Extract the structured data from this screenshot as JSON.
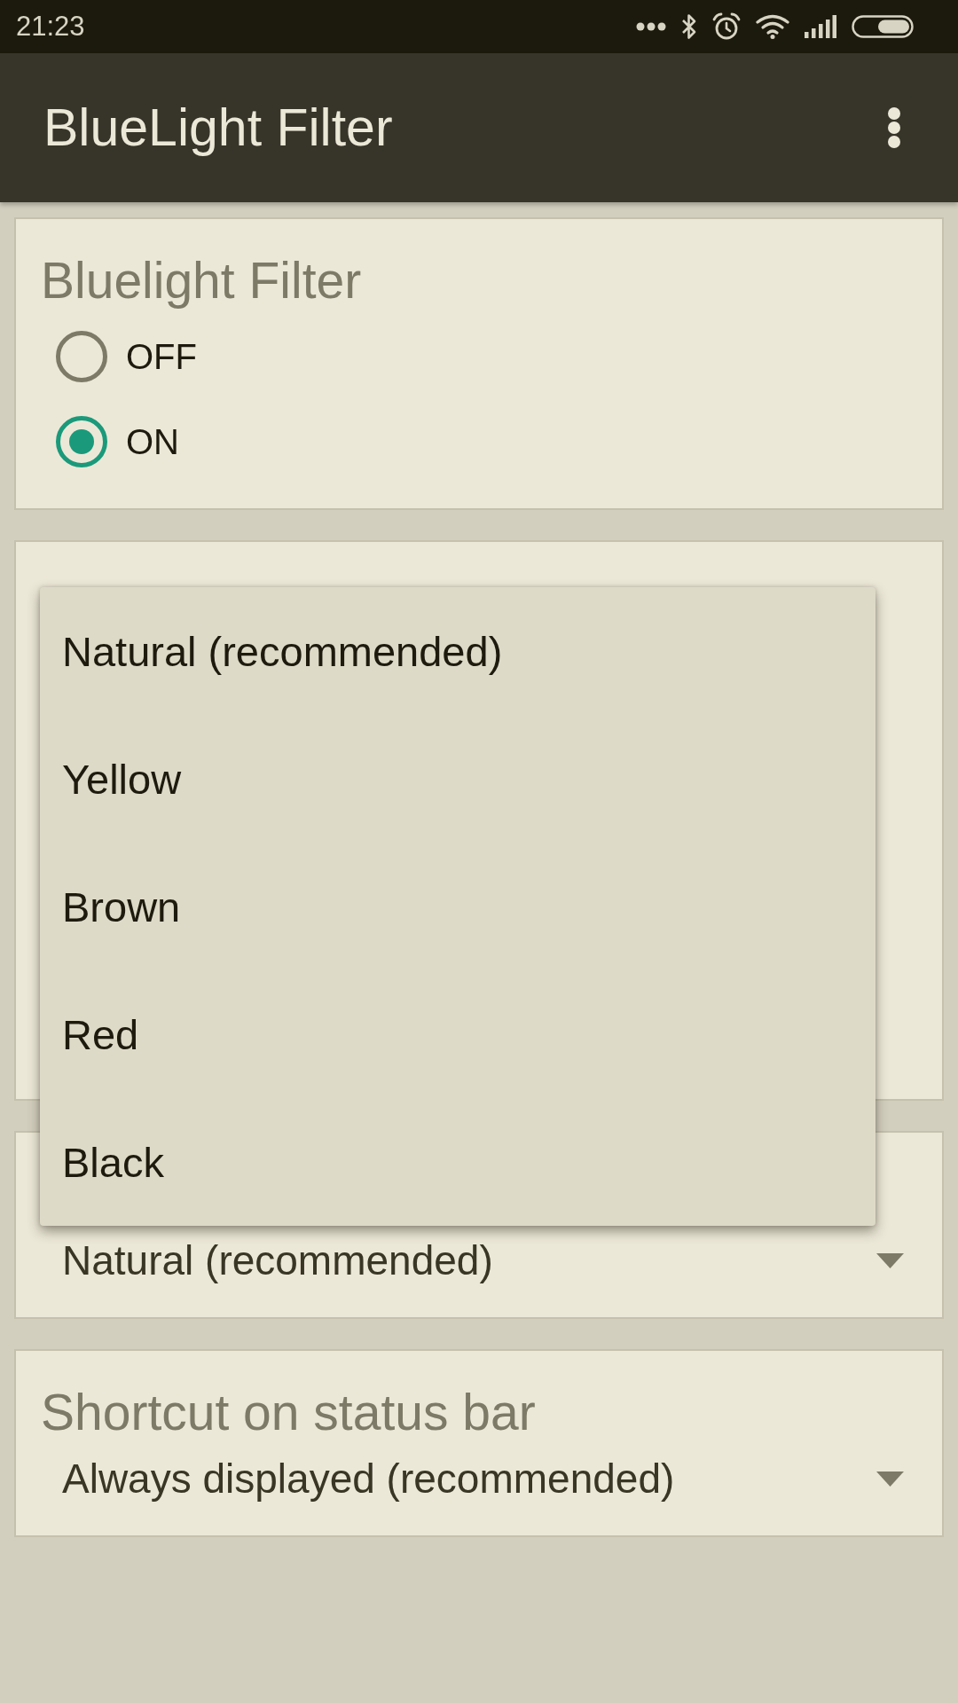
{
  "status_bar": {
    "time": "21:23"
  },
  "app_bar": {
    "title": "BlueLight Filter"
  },
  "cards": [
    {
      "kind": "radio_group",
      "title": "Bluelight Filter",
      "options": [
        {
          "label": "OFF",
          "selected": false
        },
        {
          "label": "ON",
          "selected": true
        }
      ]
    },
    {
      "kind": "covered"
    },
    {
      "kind": "dropdown",
      "value": "Natural (recommended)"
    },
    {
      "kind": "dropdown",
      "title": "Shortcut on status bar",
      "value": "Always displayed (recommended)"
    }
  ],
  "dropdown_menu": {
    "items": [
      {
        "label": "Natural (recommended)"
      },
      {
        "label": "Yellow"
      },
      {
        "label": "Brown"
      },
      {
        "label": "Red"
      },
      {
        "label": "Black"
      }
    ]
  }
}
